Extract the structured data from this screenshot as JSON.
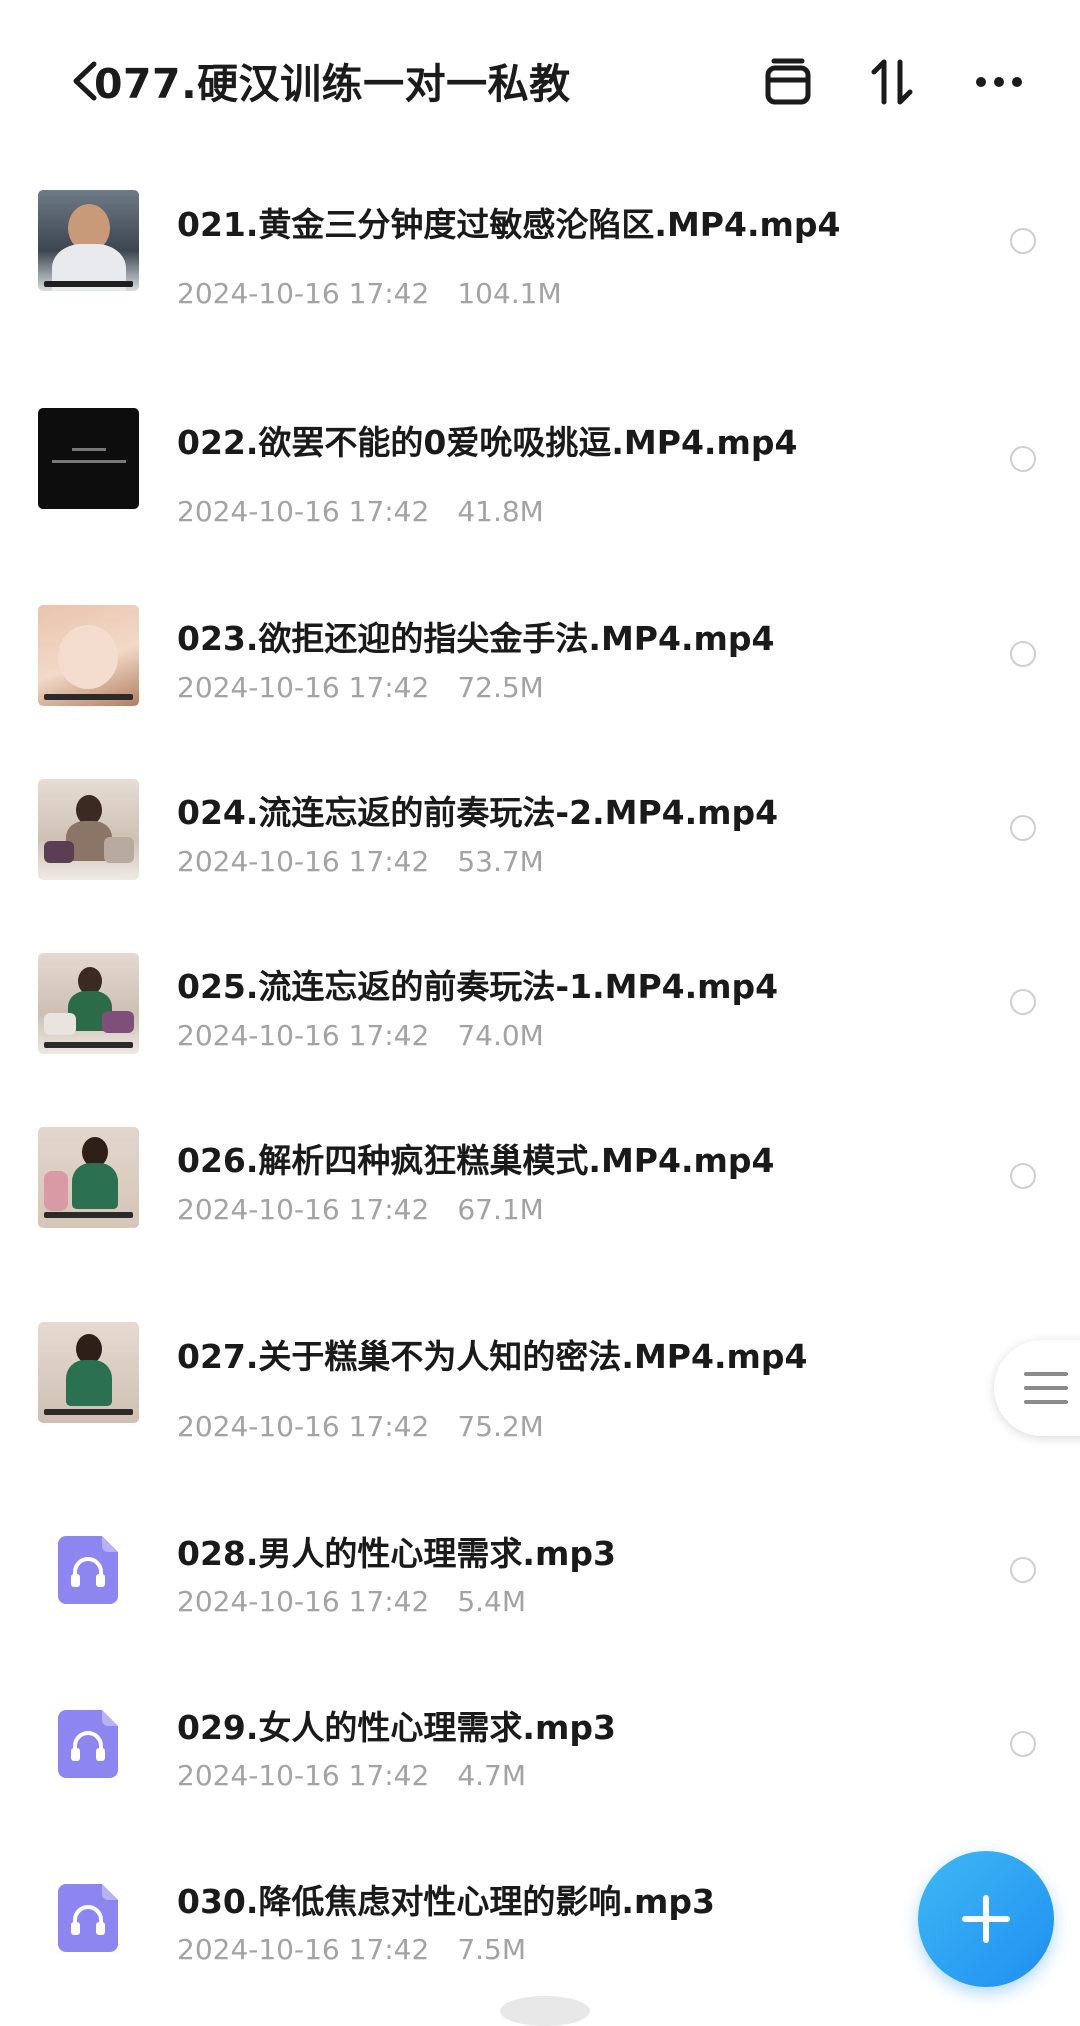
{
  "header": {
    "title": "077.硬汉训练一对一私教",
    "icons": [
      "back-icon",
      "archive-icon",
      "sort-icon",
      "more-icon"
    ]
  },
  "files": [
    {
      "name": "021.黄金三分钟度过敏感沦陷区.MP4.mp4",
      "date": "2024-10-16 17:42",
      "size": "104.1M",
      "type": "video"
    },
    {
      "name": "022.欲罢不能的0爱吮吸挑逗.MP4.mp4",
      "date": "2024-10-16 17:42",
      "size": "41.8M",
      "type": "video"
    },
    {
      "name": "023.欲拒还迎的指尖金手法.MP4.mp4",
      "date": "2024-10-16 17:42",
      "size": "72.5M",
      "type": "video"
    },
    {
      "name": "024.流连忘返的前奏玩法-2.MP4.mp4",
      "date": "2024-10-16 17:42",
      "size": "53.7M",
      "type": "video"
    },
    {
      "name": "025.流连忘返的前奏玩法-1.MP4.mp4",
      "date": "2024-10-16 17:42",
      "size": "74.0M",
      "type": "video"
    },
    {
      "name": "026.解析四种疯狂糕巢模式.MP4.mp4",
      "date": "2024-10-16 17:42",
      "size": "67.1M",
      "type": "video"
    },
    {
      "name": "027.关于糕巢不为人知的密法.MP4.mp4",
      "date": "2024-10-16 17:42",
      "size": "75.2M",
      "type": "video"
    },
    {
      "name": "028.男人的性心理需求.mp3",
      "date": "2024-10-16 17:42",
      "size": "5.4M",
      "type": "audio"
    },
    {
      "name": "029.女人的性心理需求.mp3",
      "date": "2024-10-16 17:42",
      "size": "4.7M",
      "type": "audio"
    },
    {
      "name": "030.降低焦虑对性心理的影响.mp3",
      "date": "2024-10-16 17:42",
      "size": "7.5M",
      "type": "audio"
    }
  ],
  "colors": {
    "accent": "#1e8ff0",
    "audio_icon": "#8e86f0",
    "meta_text": "#a3a3a3"
  }
}
